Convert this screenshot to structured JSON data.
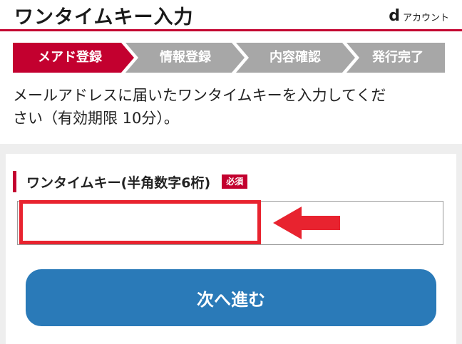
{
  "header": {
    "title": "ワンタイムキー入力",
    "brand_mark": "d",
    "brand_label": "アカウント"
  },
  "steps": [
    {
      "label": "メアド登録",
      "active": true
    },
    {
      "label": "情報登録",
      "active": false
    },
    {
      "label": "内容確認",
      "active": false
    },
    {
      "label": "発行完了",
      "active": false
    }
  ],
  "step_colors": {
    "active": "#c3002f",
    "inactive": "#a7a7a7"
  },
  "instruction": {
    "line1": "メールアドレスに届いたワンタイムキーを入力してくだ",
    "line2": "さい（有効期限 10分）。"
  },
  "form": {
    "field_label": "ワンタイムキー(半角数字6桁)",
    "required_badge": "必須",
    "input_value": "",
    "input_placeholder": ""
  },
  "annotation": {
    "highlight_color": "#e8232f",
    "arrow_icon": "left-arrow-icon"
  },
  "actions": {
    "next_label": "次へ進む",
    "next_color": "#2a7ab8"
  }
}
